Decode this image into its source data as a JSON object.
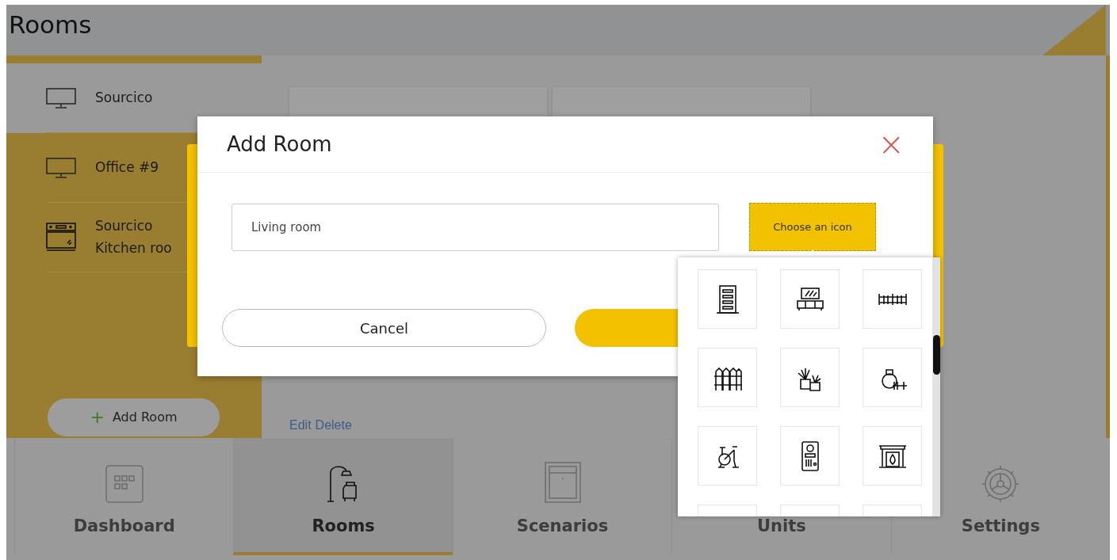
{
  "header": {
    "title": "Rooms"
  },
  "sidebar": {
    "items": [
      {
        "name": "Sourcico",
        "kind": "monitor",
        "selected": true
      },
      {
        "name": "Office #9",
        "kind": "monitor",
        "selected": false
      },
      {
        "name": "Sourcico Kitchen roo",
        "kind": "oven",
        "selected": false
      }
    ],
    "add_button": {
      "icon": "+",
      "label": "Add Room"
    }
  },
  "room_links": [
    "Edit",
    "Delete"
  ],
  "modal": {
    "title": "Add Room",
    "close": "×",
    "name_field": {
      "value": "Living room"
    },
    "choose_icon_button": "Choose an icon",
    "cancel_button": "Cancel",
    "icon_picker": {
      "tiles": [
        {
          "kind": "door"
        },
        {
          "kind": "tv-stand"
        },
        {
          "kind": "gate"
        },
        {
          "kind": "fence"
        },
        {
          "kind": "plants"
        },
        {
          "kind": "weights"
        },
        {
          "kind": "bike"
        },
        {
          "kind": "intercom"
        },
        {
          "kind": "fireplace"
        },
        {
          "kind": "blank"
        },
        {
          "kind": "blank"
        },
        {
          "kind": "blank"
        }
      ]
    }
  },
  "nav": [
    {
      "label": "Dashboard",
      "kind": "grid",
      "selected": false
    },
    {
      "label": "Rooms",
      "kind": "lamp",
      "selected": true
    },
    {
      "label": "Scenarios",
      "kind": "window",
      "selected": false
    },
    {
      "label": "Units",
      "kind": "plain",
      "selected": false
    },
    {
      "label": "Settings",
      "kind": "gear",
      "selected": false
    }
  ]
}
